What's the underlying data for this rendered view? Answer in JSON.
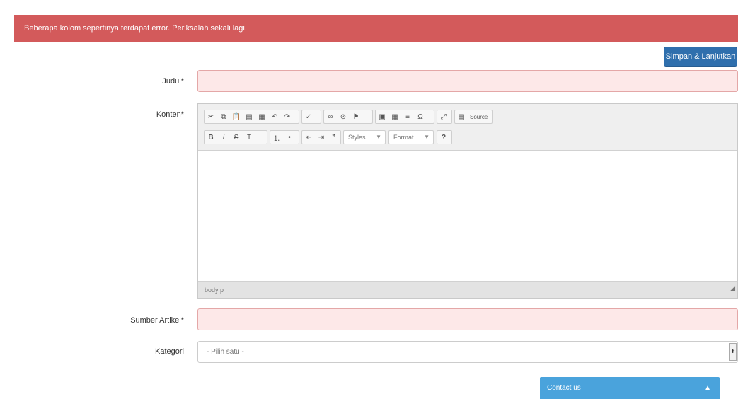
{
  "alert": {
    "text": "Beberapa kolom sepertinya terdapat error. Periksalah sekali lagi."
  },
  "actions": {
    "save_label": "Simpan & Lanjutkan"
  },
  "form": {
    "title_label": "Judul*",
    "content_label": "Konten*",
    "source_label": "Sumber Artikel*",
    "category_label": "Kategori",
    "category_value": "- Pilih satu -"
  },
  "editor": {
    "source_button": "Source",
    "styles_combo": "Styles",
    "format_combo": "Format",
    "help_icon": "?",
    "status_path": "body p"
  },
  "contact": {
    "label": "Contact us"
  }
}
